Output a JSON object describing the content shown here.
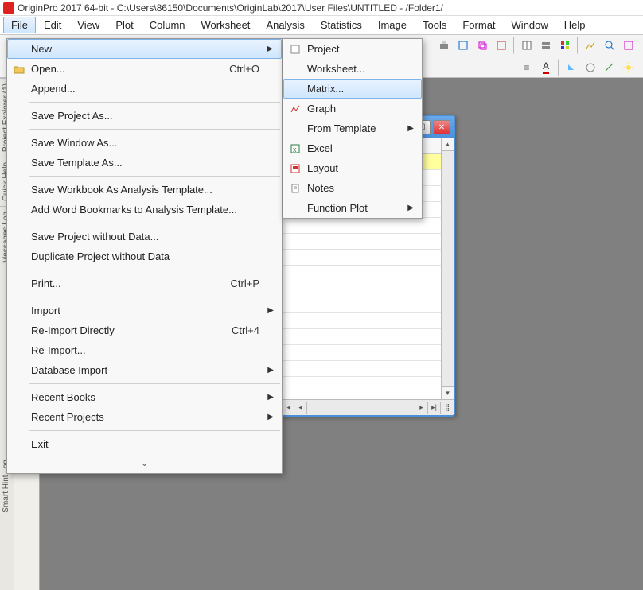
{
  "title": "OriginPro 2017 64-bit - C:\\Users\\86150\\Documents\\OriginLab\\2017\\User Files\\UNTITLED - /Folder1/",
  "menubar": [
    "File",
    "Edit",
    "View",
    "Plot",
    "Column",
    "Worksheet",
    "Analysis",
    "Statistics",
    "Image",
    "Tools",
    "Format",
    "Window",
    "Help"
  ],
  "file_menu": {
    "new": {
      "label": "New",
      "arrow": true
    },
    "open": {
      "label": "Open...",
      "shortcut": "Ctrl+O",
      "icon": "open"
    },
    "append": {
      "label": "Append..."
    },
    "save_as": {
      "label": "Save Project As..."
    },
    "save_window": {
      "label": "Save Window As..."
    },
    "save_template": {
      "label": "Save Template As..."
    },
    "save_wb_tpl": {
      "label": "Save Workbook As Analysis Template..."
    },
    "add_bookmarks": {
      "label": "Add Word Bookmarks to Analysis Template..."
    },
    "save_nodata": {
      "label": "Save Project without Data..."
    },
    "dup_nodata": {
      "label": "Duplicate Project without Data"
    },
    "print": {
      "label": "Print...",
      "shortcut": "Ctrl+P"
    },
    "import": {
      "label": "Import",
      "arrow": true
    },
    "reimport_direct": {
      "label": "Re-Import Directly",
      "shortcut": "Ctrl+4"
    },
    "reimport": {
      "label": "Re-Import..."
    },
    "db_import": {
      "label": "Database Import",
      "arrow": true
    },
    "recent_books": {
      "label": "Recent Books",
      "arrow": true
    },
    "recent_projects": {
      "label": "Recent Projects",
      "arrow": true
    },
    "exit": {
      "label": "Exit"
    },
    "more_glyph": "⌄"
  },
  "new_submenu": {
    "project": {
      "label": "Project"
    },
    "worksheet": {
      "label": "Worksheet..."
    },
    "matrix": {
      "label": "Matrix..."
    },
    "graph": {
      "label": "Graph"
    },
    "from_template": {
      "label": "From Template",
      "arrow": true
    },
    "excel": {
      "label": "Excel"
    },
    "layout": {
      "label": "Layout"
    },
    "notes": {
      "label": "Notes"
    },
    "function_plot": {
      "label": "Function Plot",
      "arrow": true
    }
  },
  "left_tabs": {
    "project_explorer": "Project Explorer (1)",
    "quick_help": "Quick Help",
    "messages": "Messages Log",
    "smart_hint": "Smart Hint Log"
  }
}
